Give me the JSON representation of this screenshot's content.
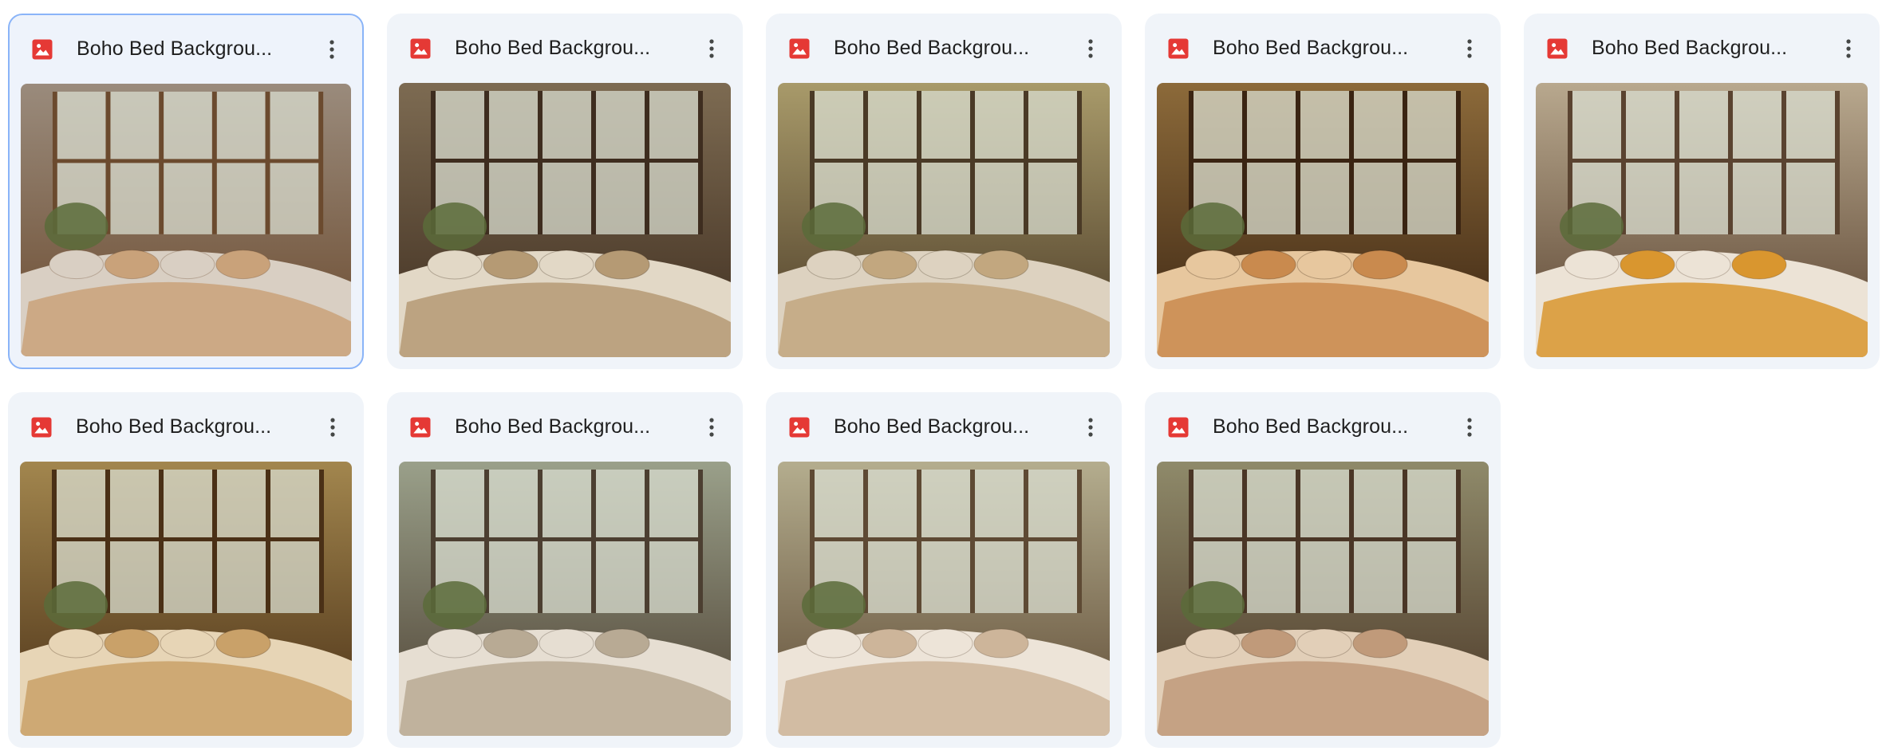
{
  "files": [
    {
      "title": "Boho Bed Backgrou...",
      "selected": true,
      "icon": "image-file-icon",
      "palette": [
        "#9a8b7c",
        "#6b4a2e",
        "#c9a27a",
        "#d9cfc3"
      ]
    },
    {
      "title": "Boho Bed Backgrou...",
      "selected": false,
      "icon": "image-file-icon",
      "palette": [
        "#7d6b52",
        "#3e2d1f",
        "#b59a74",
        "#e2d8c6"
      ]
    },
    {
      "title": "Boho Bed Backgrou...",
      "selected": false,
      "icon": "image-file-icon",
      "palette": [
        "#a89a6a",
        "#4a3a26",
        "#c2a77f",
        "#ddd2c0"
      ]
    },
    {
      "title": "Boho Bed Backgrou...",
      "selected": false,
      "icon": "image-file-icon",
      "palette": [
        "#8c6a3a",
        "#3a2412",
        "#c98a4e",
        "#e7c79e"
      ]
    },
    {
      "title": "Boho Bed Backgrou...",
      "selected": false,
      "icon": "image-file-icon",
      "palette": [
        "#b8a88e",
        "#5a4330",
        "#d9962f",
        "#ece3d6"
      ]
    },
    {
      "title": "Boho Bed Backgrou...",
      "selected": false,
      "icon": "image-file-icon",
      "palette": [
        "#a2864e",
        "#4a3016",
        "#c9a169",
        "#e7d5b6"
      ]
    },
    {
      "title": "Boho Bed Backgrou...",
      "selected": false,
      "icon": "image-file-icon",
      "palette": [
        "#9aa08a",
        "#4c3f31",
        "#b8aa94",
        "#e6ded2"
      ]
    },
    {
      "title": "Boho Bed Backgrou...",
      "selected": false,
      "icon": "image-file-icon",
      "palette": [
        "#b4ad8e",
        "#5e4a34",
        "#cdb59a",
        "#ede4d8"
      ]
    },
    {
      "title": "Boho Bed Backgrou...",
      "selected": false,
      "icon": "image-file-icon",
      "palette": [
        "#8f8a6a",
        "#4a3626",
        "#c09a7a",
        "#e2cfb8"
      ]
    }
  ]
}
